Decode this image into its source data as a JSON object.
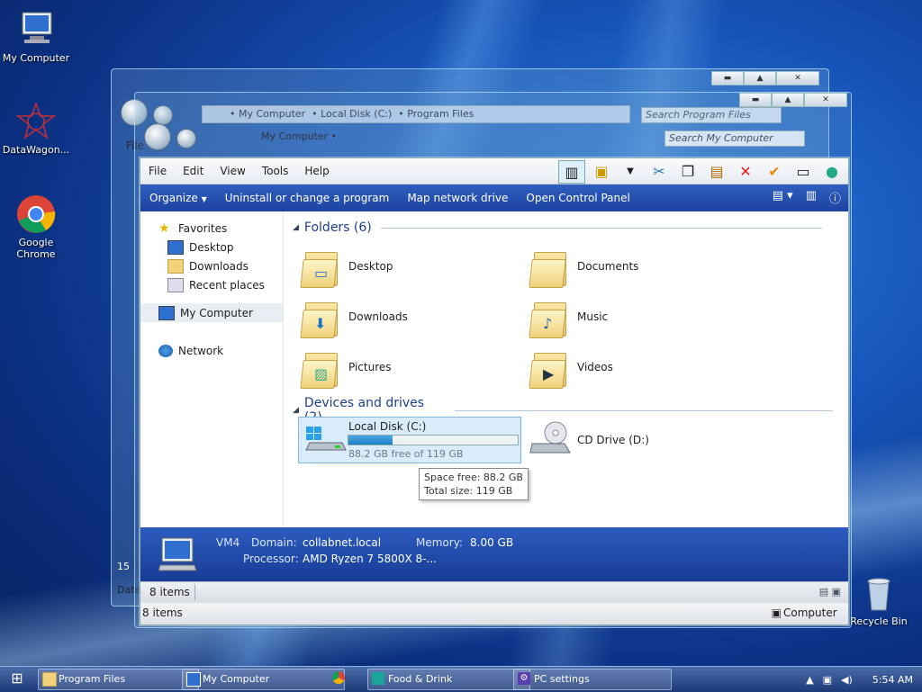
{
  "desktop": {
    "icons": [
      {
        "label": "My Computer"
      },
      {
        "label": "DataWagon..."
      },
      {
        "label": "Google Chrome"
      },
      {
        "label": "Recycle Bin"
      }
    ]
  },
  "back_window_1": {
    "address": [
      "My Computer",
      "Local Disk (C:)",
      "Program Files"
    ],
    "search_placeholder": "Search Program Files",
    "menu": [
      "File",
      "Edit",
      "View",
      "Tools",
      "Help"
    ],
    "status": "8 items",
    "side_text": "Date",
    "side_num": "15"
  },
  "back_window_2": {
    "address": [
      "My Computer"
    ],
    "search_placeholder": "Search My Computer"
  },
  "window": {
    "menu": [
      "File",
      "Edit",
      "View",
      "Tools",
      "Help"
    ],
    "commands": [
      "Organize",
      "Uninstall or change a program",
      "Map network drive",
      "Open Control Panel"
    ],
    "organize_arrow": "▼",
    "nav": [
      {
        "label": "Favorites",
        "icon": "star-icon",
        "indent": false
      },
      {
        "label": "Desktop",
        "icon": "desktop-icon",
        "indent": true
      },
      {
        "label": "Downloads",
        "icon": "downloads-icon",
        "indent": true
      },
      {
        "label": "Recent places",
        "icon": "recent-places-icon",
        "indent": true
      },
      {
        "label": "My Computer",
        "icon": "computer-icon",
        "indent": false,
        "selected": true
      },
      {
        "label": "Network",
        "icon": "network-icon",
        "indent": false
      }
    ],
    "folders_header": "Folders (6)",
    "folders": [
      {
        "label": "Desktop",
        "glyph": "▭"
      },
      {
        "label": "Documents",
        "glyph": ""
      },
      {
        "label": "Downloads",
        "glyph": "⬇"
      },
      {
        "label": "Music",
        "glyph": "♪"
      },
      {
        "label": "Pictures",
        "glyph": "▨"
      },
      {
        "label": "Videos",
        "glyph": "▶"
      }
    ],
    "devices_header": "Devices and drives (2)",
    "drive_c": {
      "name": "Local Disk (C:)",
      "free_text": "88.2 GB free of 119 GB",
      "used_fraction": 0.26
    },
    "drive_d": {
      "name": "CD Drive (D:)"
    },
    "tooltip": {
      "line1": "Space free: 88.2 GB",
      "line2": "Total size: 119 GB"
    },
    "details": {
      "name": "VM4",
      "domain_label": "Domain:",
      "domain_value": "collabnet.local",
      "memory_label": "Memory:",
      "memory_value": "8.00 GB",
      "processor_label": "Processor:",
      "processor_value": "AMD Ryzen 7 5800X 8-..."
    },
    "status": "8 items",
    "status2_left": "8 items",
    "status2_right": "Computer"
  },
  "taskbar": {
    "tasks": [
      "Program Files",
      "My Computer",
      "",
      "Food & Drink",
      "PC settings"
    ],
    "clock": "5:54 AM"
  },
  "colors": {
    "accent": "#1d43a0",
    "selection": "#d9ecf9",
    "folder": "#efd27a"
  }
}
